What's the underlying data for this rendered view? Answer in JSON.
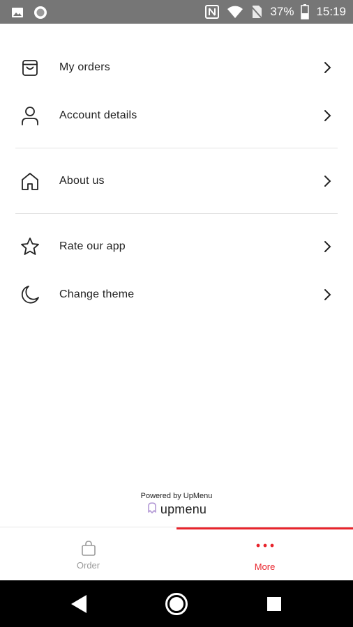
{
  "status_bar": {
    "battery": "37%",
    "time": "15:19",
    "icons": [
      "image-icon",
      "circle-icon",
      "nfc-icon",
      "wifi-icon",
      "no-sim-icon",
      "battery-icon"
    ]
  },
  "menu": {
    "items": [
      {
        "label": "My orders",
        "icon": "shopping-bag-icon"
      },
      {
        "label": "Account details",
        "icon": "user-icon"
      },
      {
        "label": "About us",
        "icon": "home-icon"
      },
      {
        "label": "Rate our app",
        "icon": "star-icon"
      },
      {
        "label": "Change theme",
        "icon": "moon-icon"
      }
    ]
  },
  "footer": {
    "powered_by": "Powered by UpMenu",
    "brand": "upmenu"
  },
  "bottom_nav": {
    "order_label": "Order",
    "more_label": "More",
    "active_tab": "More",
    "accent_color": "#e8242c"
  },
  "colors": {
    "status_bar_bg": "#767676",
    "accent": "#e8242c",
    "system_nav_bg": "#000000"
  }
}
